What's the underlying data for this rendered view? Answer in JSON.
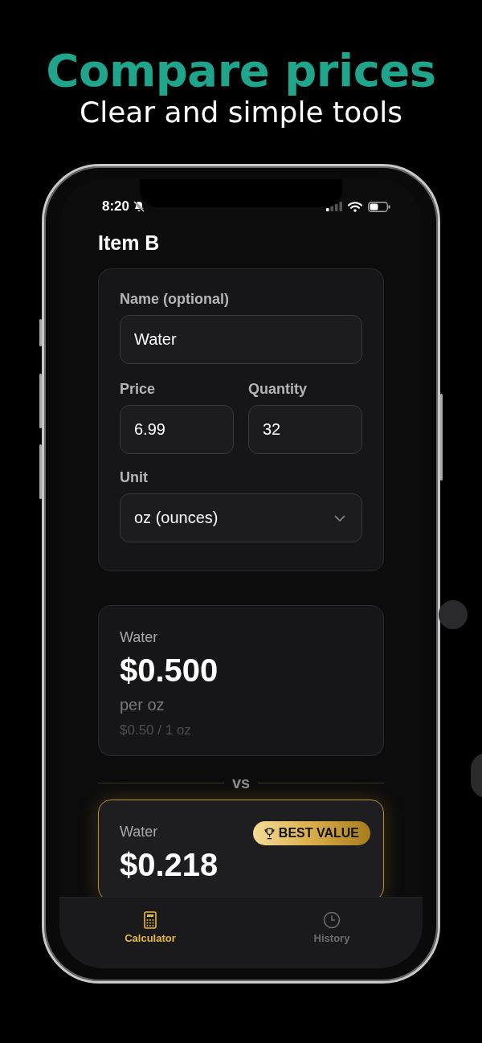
{
  "headline": {
    "title": "Compare prices",
    "subtitle": "Clear and simple tools"
  },
  "status_bar": {
    "time": "8:20",
    "silent": true
  },
  "page_title": "Item B",
  "form": {
    "name_field": {
      "label": "Name (optional)",
      "value": "Water"
    },
    "pair_fields": [
      {
        "label": "Price",
        "value": "6.99"
      },
      {
        "label": "Quantity",
        "value": "32"
      }
    ],
    "unit": {
      "label": "Unit",
      "value": "oz (ounces)"
    }
  },
  "results": [
    {
      "name": "Water",
      "price": "$0.500",
      "per": "per oz",
      "detail": "$0.50 / 1 oz",
      "best": false
    },
    {
      "name": "Water",
      "price": "$0.218",
      "badge": "BEST VALUE",
      "best": true
    }
  ],
  "divider": "vs",
  "tabs": [
    {
      "label": "Calculator",
      "kind": "calculator",
      "selected": true
    },
    {
      "label": "History",
      "kind": "clock",
      "selected": false
    }
  ]
}
